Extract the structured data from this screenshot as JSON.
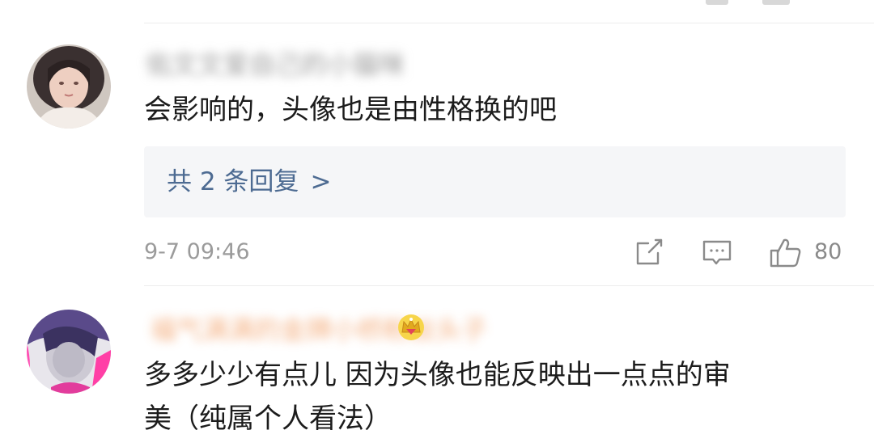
{
  "comments": [
    {
      "username": "佑文文爱自己的小猫咪",
      "text": "会影响的，头像也是由性格换的吧",
      "replies": "共 2 条回复",
      "reply_chevron": ">",
      "timestamp": "9-7 09:46",
      "like_count": "80"
    },
    {
      "username": "福气满满的金牌小桥粉丝头子",
      "badge_icon": "crown-icon",
      "text_line1": "多多少少有点儿  因为头像也能反映出一点点的审",
      "text_line2": "美（纯属个人看法）"
    }
  ],
  "icons": {
    "share": "share-icon",
    "comment": "comment-icon",
    "like": "thumbs-up-icon"
  },
  "colors": {
    "reply_link": "#4d6b92",
    "meta_gray": "#9b9b9b",
    "reply_bg": "#f5f6f8"
  }
}
